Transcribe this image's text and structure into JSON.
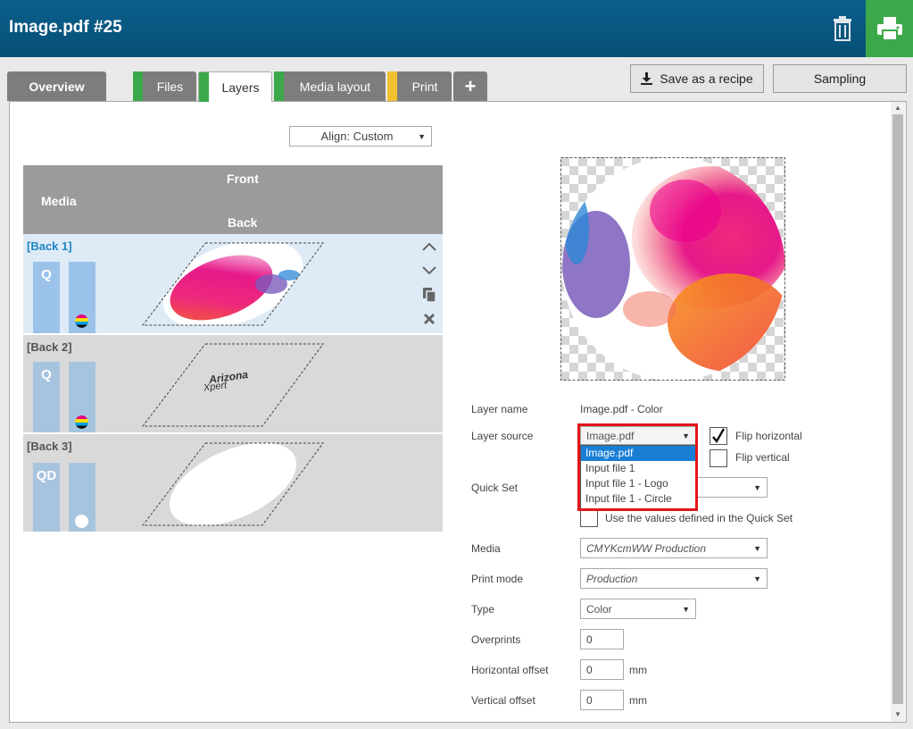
{
  "window": {
    "title": "Image.pdf #25"
  },
  "header": {
    "delete_icon": "trash-icon",
    "print_icon": "printer-icon"
  },
  "tabs": [
    {
      "label": "Overview",
      "stripe": ""
    },
    {
      "label": "Files",
      "stripe": "#3ba949"
    },
    {
      "label": "Layers",
      "stripe": "#3ba949",
      "active": true
    },
    {
      "label": "Media layout",
      "stripe": "#3ba949"
    },
    {
      "label": "Print",
      "stripe": "#f2c12e"
    },
    {
      "label": "+"
    }
  ],
  "toolbar": {
    "save_recipe": "Save as a recipe",
    "sampling": "Sampling"
  },
  "align": {
    "value": "Align: Custom"
  },
  "layer_table": {
    "front": "Front",
    "media": "Media",
    "back": "Back",
    "rows": [
      {
        "label": "[Back 1]",
        "bar1": "Q",
        "selected": true
      },
      {
        "label": "[Back 2]",
        "bar1": "Q",
        "thumb_text1": "Arizona",
        "thumb_text2": "Xpert"
      },
      {
        "label": "[Back 3]",
        "bar1": "QD"
      }
    ]
  },
  "form": {
    "layer_name_label": "Layer name",
    "layer_name_value": "Image.pdf - Color",
    "layer_source_label": "Layer source",
    "layer_source_value": "Image.pdf",
    "layer_source_options": [
      "Image.pdf",
      "Input file 1",
      "Input file 1 - Logo",
      "Input file 1 - Circle"
    ],
    "flip_horizontal": "Flip horizontal",
    "flip_horizontal_checked": true,
    "flip_vertical": "Flip vertical",
    "flip_vertical_checked": false,
    "quick_set_label": "Quick Set",
    "quick_set_value": "",
    "use_quickset": "Use the values defined in the Quick Set",
    "media_label": "Media",
    "media_value": "CMYKcmWW Production",
    "print_mode_label": "Print mode",
    "print_mode_value": "Production",
    "type_label": "Type",
    "type_value": "Color",
    "overprints_label": "Overprints",
    "overprints_value": "0",
    "h_offset_label": "Horizontal offset",
    "h_offset_value": "0",
    "h_offset_unit": "mm",
    "v_offset_label": "Vertical offset",
    "v_offset_value": "0",
    "v_offset_unit": "mm"
  }
}
